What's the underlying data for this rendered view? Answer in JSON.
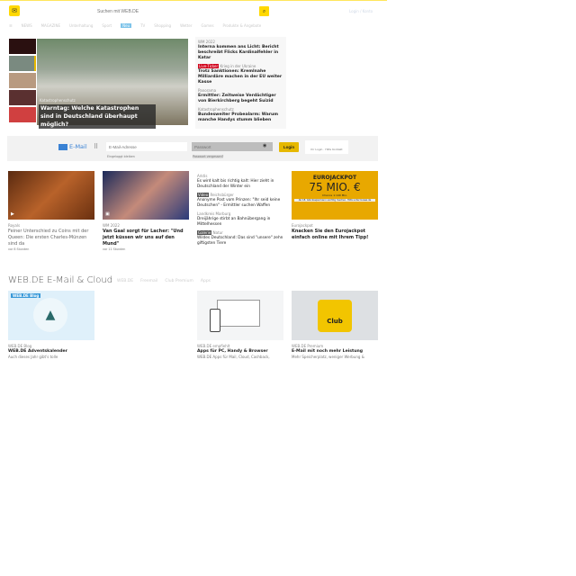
{
  "header": {
    "search_placeholder": "Suchen mit WEB.DE",
    "top_link": "Login / Konto"
  },
  "nav": [
    "NEWS",
    "MAGAZINE",
    "Unterhaltung",
    "Sport",
    "Neu",
    "TV",
    "Shopping",
    "Wetter",
    "Games",
    "Produkte & Angebote"
  ],
  "hero": {
    "kicker": "Katastrophenschutz",
    "title": "Warntag: Welche Katastrophen sind in Deutschland überhaupt möglich?"
  },
  "side": [
    {
      "kicker": "WM 2022",
      "title": "Interna kommen ans Licht: Bericht beschreibt Flicks Kardinalfehler in Katar"
    },
    {
      "badge": "Live-Ticker",
      "kicker": "Krieg in der Ukraine",
      "title": "Trotz Sanktionen: Kremlnahe Milliardäre machen in der EU weiter Kasse"
    },
    {
      "kicker": "Panorama",
      "title": "Ermittler: Zeitweise Verdächtiger von Bierkirchberg begeht Suizid"
    },
    {
      "kicker": "Katastrophenschutz",
      "title": "Bundesweiter Probealarm: Warum manche Handys stumm blieben"
    }
  ],
  "login": {
    "mail_label": "E-Mail",
    "email_placeholder": "E-Mail-Adresse",
    "stay_logged": "Eingeloggt bleiben",
    "password_placeholder": "Passwort",
    "forgot": "Passwort vergessen?",
    "login_label": "Login",
    "social": "Ihr Login · Hilfe Kontakt"
  },
  "teasers": [
    {
      "kicker": "Royals",
      "title": "Feiner Unterschied zu Coins mit der Queen: Die ersten Charles-Münzen sind da",
      "time": "vor 8 Stunden"
    },
    {
      "kicker": "WM 2022",
      "title": "Van Gaal sorgt für Lacher: \"Und jetzt küssen wir uns auf den Mund\"",
      "time": "vor 11 Stunden"
    }
  ],
  "list": [
    {
      "kicker": "Arktis",
      "title": "Es wird kalt bis richtig kalt: Hier zieht in Deutschland der Winter ein"
    },
    {
      "badge": "Video",
      "kicker": "Reichsbürger",
      "title": "Anonyme Post vom Prinzen: \"Ihr seid keine Deutschen\" - Ermittler suchen Waffen"
    },
    {
      "kicker": "Landkreis Marburg",
      "title": "Dreijährige stirbt an Bahnübergang in Mittelhessen"
    },
    {
      "badge": "Galerie",
      "kicker": "Natur",
      "title": "Wildes Deutschland: Das sind \"unsere\" zehn giftigsten Tiere"
    }
  ],
  "jackpot": {
    "brand": "EUROJACKPOT",
    "amount": "75 MIO. €",
    "sub": "Chance 1:140 Mio.",
    "fine": "Ab 18. Glücksspiel kann süchtig machen. Hilfe unter buwei.de",
    "kicker": "Eurojackpot",
    "title": "Knacken Sie den Eurojackpot einfach online mit Ihrem Tipp!"
  },
  "section": {
    "title": "WEB.DE E-Mail & Cloud",
    "links": [
      "WEB.DE",
      "Freemail",
      "Club Premium",
      "Apps"
    ]
  },
  "cards": [
    {
      "tag": "WEB.DE Blog",
      "kicker": "WEB.DE Blog",
      "title": "WEB.DE Adventskalender",
      "body": "Auch dieses Jahr gibt's tolle"
    },
    {
      "kicker": "WEB.DE empfiehlt",
      "title": "Apps für PC, Handy & Browser",
      "body": "WEB.DE Apps für Mail, Cloud, Cashback,"
    },
    {
      "logo": "Club",
      "kicker": "WEB.DE Premium",
      "title": "E-Mail mit noch mehr Leistung",
      "body": "Mehr Speicherplatz, weniger Werbung &"
    }
  ]
}
